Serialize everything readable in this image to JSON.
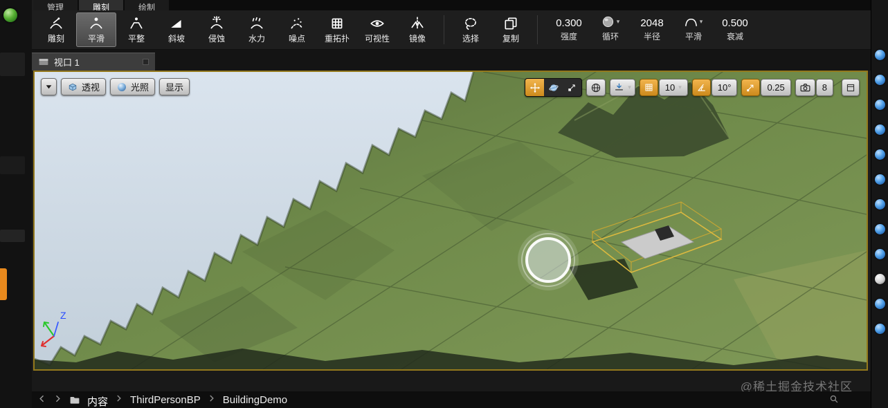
{
  "colors": {
    "accent_orange": "#D0942B",
    "viewport_border": "#94791C",
    "button_light": "#DCDCDC",
    "panel_dark": "#1E1E1E",
    "icon_blue": "#5DB7FF",
    "terrain_green": "#6F8A4A",
    "sky_blue": "#D0DCE6"
  },
  "mode_tabs": [
    {
      "name": "manage",
      "label": "管理",
      "active": false
    },
    {
      "name": "sculpt",
      "label": "雕刻",
      "active": true
    },
    {
      "name": "paint",
      "label": "绘制",
      "active": false
    }
  ],
  "toolbar": {
    "tools": [
      {
        "name": "sculpt",
        "label": "雕刻",
        "icon": "sculpt-icon",
        "active": false
      },
      {
        "name": "smooth",
        "label": "平滑",
        "icon": "smooth-icon",
        "active": true
      },
      {
        "name": "flatten",
        "label": "平整",
        "icon": "flatten-icon",
        "active": false
      },
      {
        "name": "ramp",
        "label": "斜坡",
        "icon": "ramp-icon",
        "active": false
      },
      {
        "name": "erosion",
        "label": "侵蚀",
        "icon": "erosion-icon",
        "active": false
      },
      {
        "name": "hydro",
        "label": "水力",
        "icon": "hydro-icon",
        "active": false
      },
      {
        "name": "noise",
        "label": "噪点",
        "icon": "noise-icon",
        "active": false
      },
      {
        "name": "retopo",
        "label": "重拓扑",
        "icon": "retopo-icon",
        "active": false
      },
      {
        "name": "visibility",
        "label": "可视性",
        "icon": "visibility-icon",
        "active": false
      },
      {
        "name": "mirror",
        "label": "镜像",
        "icon": "mirror-icon",
        "active": false,
        "separator_after": true
      },
      {
        "name": "select",
        "label": "选择",
        "icon": "select-icon",
        "active": false
      },
      {
        "name": "copy",
        "label": "复制",
        "icon": "copy-icon",
        "active": false,
        "separator_after": true
      }
    ],
    "settings": [
      {
        "name": "strength",
        "type": "number",
        "value": "0.300",
        "label": "强度"
      },
      {
        "name": "loop",
        "type": "dropdown",
        "icon": "loop-sphere-icon",
        "label": "循环"
      },
      {
        "name": "radius",
        "type": "number",
        "value": "2048",
        "label": "半径"
      },
      {
        "name": "falloff",
        "type": "dropdown",
        "icon": "falloff-smooth-icon",
        "label": "平滑"
      },
      {
        "name": "decay",
        "type": "number",
        "value": "0.500",
        "label": "衰减"
      }
    ]
  },
  "viewport": {
    "tab_label": "视口 1",
    "view_buttons": [
      {
        "name": "perspective",
        "label": "透视",
        "icon": "perspective-icon"
      },
      {
        "name": "lit",
        "label": "光照",
        "icon": "lit-icon"
      },
      {
        "name": "show",
        "label": "显示",
        "icon": null
      }
    ],
    "snap": {
      "grid_size": "10",
      "angle": "10°",
      "scale": "0.25",
      "camera_speed": "8"
    },
    "axis_label_z": "Z"
  },
  "content_browser": {
    "root": "内容",
    "path": [
      "ThirdPersonBP",
      "BuildingDemo"
    ]
  },
  "watermark": "@稀土掘金技术社区",
  "right_dock": {
    "icon_count": 12,
    "highlight_index": 9,
    "icon": "panel-tab-icon"
  }
}
